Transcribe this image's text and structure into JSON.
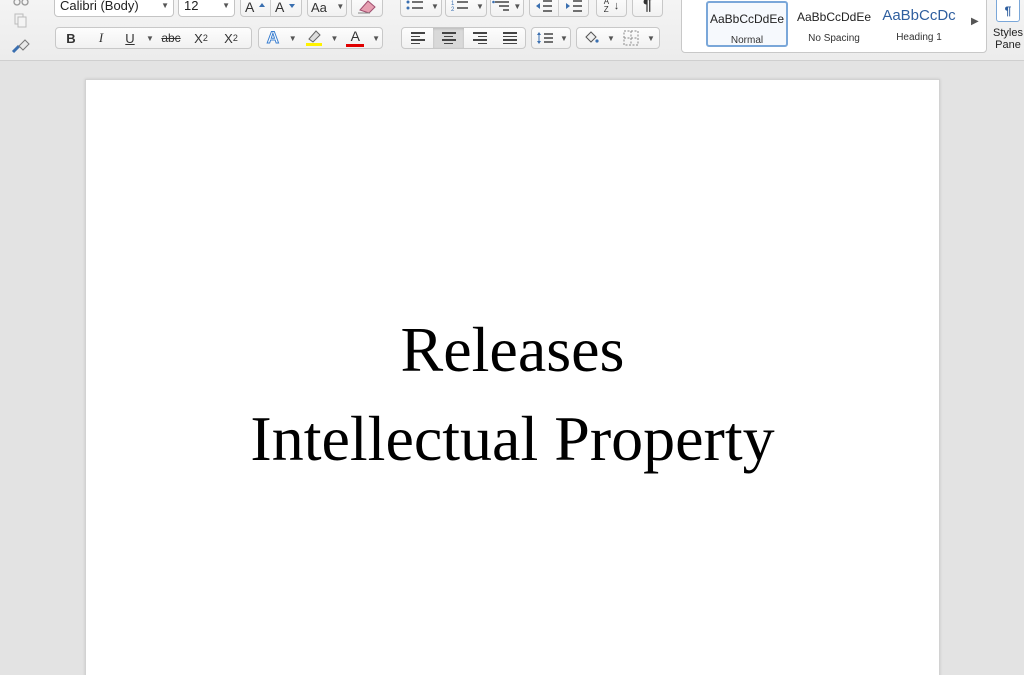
{
  "ribbon": {
    "font_name": "Calibri (Body)",
    "font_size": "12",
    "icons": {
      "cut": "scissors-icon",
      "copy": "copy-icon",
      "format_painter": "paintbrush-icon",
      "grow": "grow-font-icon",
      "shrink": "shrink-font-icon",
      "change_case": "change-case-icon",
      "clear": "eraser-icon"
    },
    "format": {
      "bold": "B",
      "italic": "I",
      "underline": "U",
      "strikethrough": "abc",
      "subscript": "X",
      "superscript": "X",
      "sub_mark": "2",
      "sup_mark": "2",
      "text_effects": "A",
      "font_color": "A"
    },
    "paragraph": {
      "sort_label": "A Z",
      "pilcrow": "¶",
      "alignment_selected": "center"
    },
    "colors": {
      "highlight": "#fff200",
      "font_color": "#e00000",
      "accent": "#7aa7d9"
    },
    "styles": [
      {
        "sample": "AaBbCcDdEe",
        "name": "Normal",
        "active": true
      },
      {
        "sample": "AaBbCcDdEe",
        "name": "No Spacing",
        "active": false
      },
      {
        "sample": "AaBbCcDc",
        "name": "Heading 1",
        "active": false
      }
    ],
    "styles_pane_label": "Styles Pane",
    "styles_pane_line1": "Styles",
    "styles_pane_line2": "Pane"
  },
  "document": {
    "lines": [
      "Releases",
      "Intellectual Property"
    ]
  }
}
